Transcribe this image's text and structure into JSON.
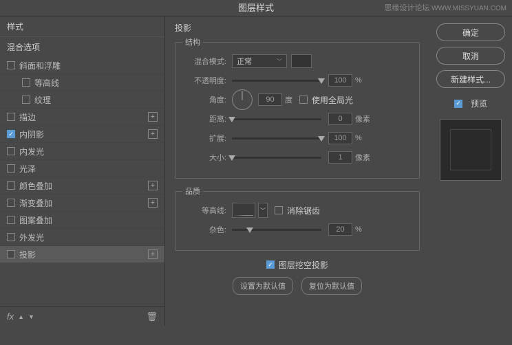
{
  "title": "图层样式",
  "watermark": {
    "cn": "思缘设计论坛",
    "en": "WWW.MISSYUAN.COM"
  },
  "sidebar": {
    "header": "样式",
    "subheader": "混合选项",
    "items": [
      {
        "label": "斜面和浮雕",
        "checked": false,
        "hasAdd": false,
        "sub": false
      },
      {
        "label": "等高线",
        "checked": false,
        "hasAdd": false,
        "sub": true
      },
      {
        "label": "纹理",
        "checked": false,
        "hasAdd": false,
        "sub": true
      },
      {
        "label": "描边",
        "checked": false,
        "hasAdd": true,
        "sub": false
      },
      {
        "label": "内阴影",
        "checked": true,
        "hasAdd": true,
        "sub": false
      },
      {
        "label": "内发光",
        "checked": false,
        "hasAdd": false,
        "sub": false
      },
      {
        "label": "光泽",
        "checked": false,
        "hasAdd": false,
        "sub": false
      },
      {
        "label": "颜色叠加",
        "checked": false,
        "hasAdd": true,
        "sub": false
      },
      {
        "label": "渐变叠加",
        "checked": false,
        "hasAdd": true,
        "sub": false
      },
      {
        "label": "图案叠加",
        "checked": false,
        "hasAdd": false,
        "sub": false
      },
      {
        "label": "外发光",
        "checked": false,
        "hasAdd": false,
        "sub": false
      },
      {
        "label": "投影",
        "checked": false,
        "hasAdd": true,
        "sub": false,
        "selected": true
      }
    ],
    "fx": "fx"
  },
  "main": {
    "title": "投影",
    "structure": {
      "legend": "结构",
      "blend_mode_label": "混合模式:",
      "blend_mode_value": "正常",
      "opacity_label": "不透明度:",
      "opacity_value": "100",
      "opacity_unit": "%",
      "angle_label": "角度:",
      "angle_value": "90",
      "angle_unit": "度",
      "global_light_label": "使用全局光",
      "distance_label": "距离:",
      "distance_value": "0",
      "distance_unit": "像素",
      "spread_label": "扩展:",
      "spread_value": "100",
      "spread_unit": "%",
      "size_label": "大小:",
      "size_value": "1",
      "size_unit": "像素"
    },
    "quality": {
      "legend": "品质",
      "contour_label": "等高线:",
      "antialias_label": "消除锯齿",
      "noise_label": "杂色:",
      "noise_value": "20",
      "noise_unit": "%"
    },
    "knockout_checked": true,
    "knockout_label": "图层挖空投影",
    "set_default": "设置为默认值",
    "reset_default": "复位为默认值"
  },
  "actions": {
    "ok": "确定",
    "cancel": "取消",
    "new_style": "新建样式...",
    "preview": "预览"
  }
}
